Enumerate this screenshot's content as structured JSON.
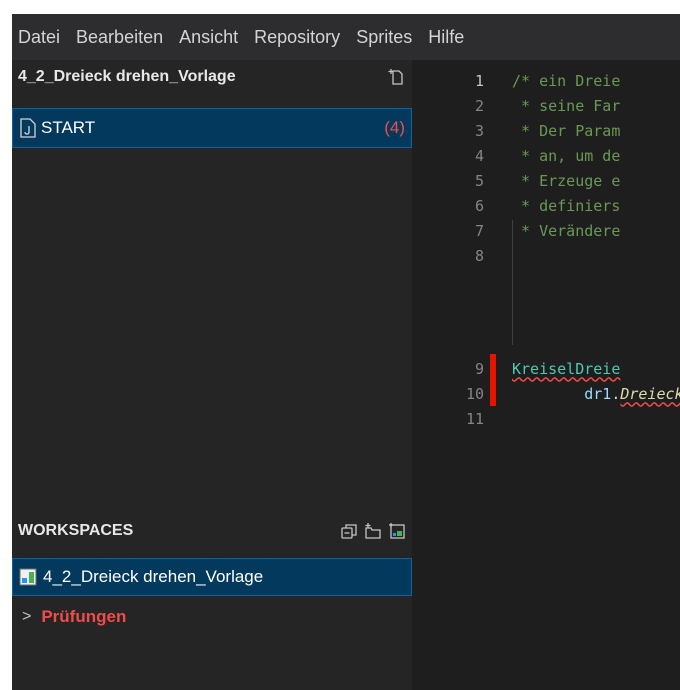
{
  "menubar": {
    "items": [
      "Datei",
      "Bearbeiten",
      "Ansicht",
      "Repository",
      "Sprites",
      "Hilfe"
    ]
  },
  "explorer": {
    "title": "4_2_Dreieck drehen_Vorlage",
    "file": {
      "name": "START",
      "problem_count": "(4)"
    }
  },
  "workspaces": {
    "title": "WORKSPACES",
    "items": [
      {
        "label": "4_2_Dreieck drehen_Vorlage"
      }
    ],
    "tree": [
      {
        "label": "Prüfungen"
      }
    ]
  },
  "editor": {
    "lines": [
      {
        "num": "1",
        "text": "/* ein Dreie"
      },
      {
        "num": "2",
        "text": " * seine Far"
      },
      {
        "num": "3",
        "text": " * Der Param"
      },
      {
        "num": "4",
        "text": " * an, um de"
      },
      {
        "num": "5",
        "text": " * Erzeuge e"
      },
      {
        "num": "6",
        "text": " * definiers"
      },
      {
        "num": "7",
        "text": " * Verändere"
      },
      {
        "num": "8",
        "text": ""
      },
      {
        "num": "9",
        "cls": "KreiselDreie"
      },
      {
        "num": "10",
        "obj": "dr1",
        "dot": ".",
        "method": "DreieckD"
      },
      {
        "num": "11",
        "text": ""
      }
    ]
  },
  "colors": {
    "accent": "#0e639c",
    "error": "#f14c4c",
    "comment": "#6a9955"
  }
}
